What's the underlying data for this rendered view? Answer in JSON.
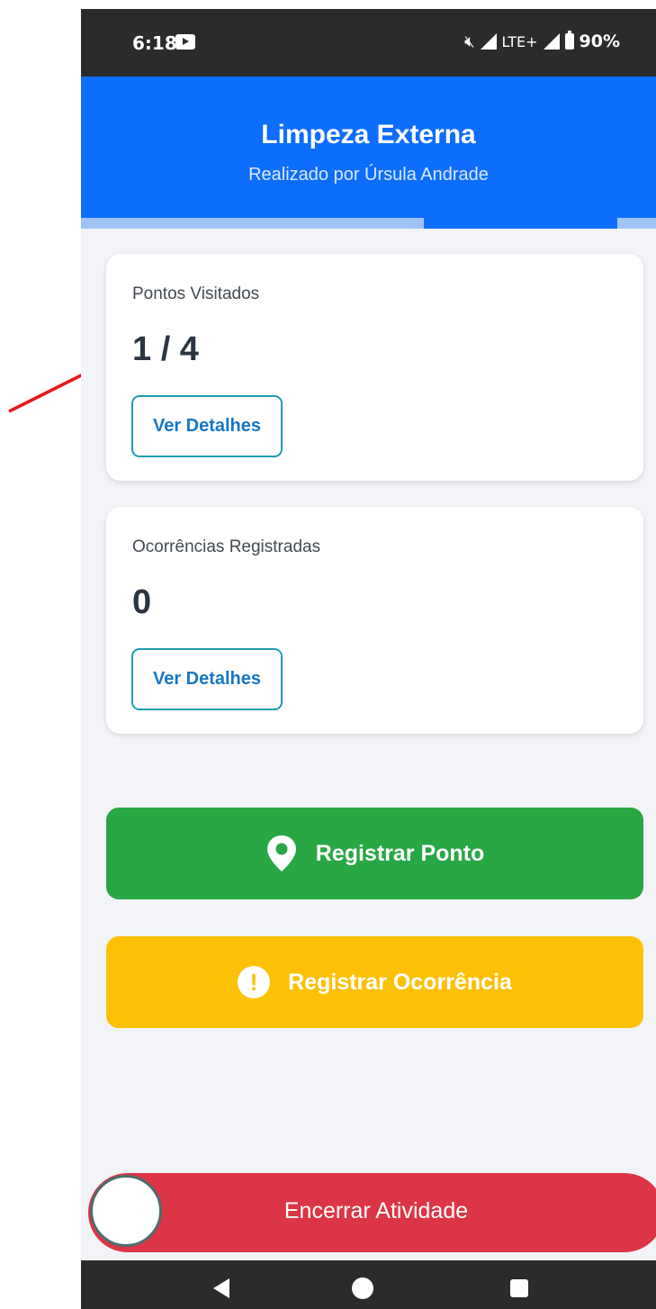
{
  "status_bar": {
    "time": "6:18",
    "network": "LTE+",
    "battery": "90%",
    "icons": [
      "youtube-icon",
      "mute-icon",
      "signal-icon",
      "battery-icon"
    ]
  },
  "header": {
    "title": "Limpeza Externa",
    "subtitle": "Realizado por Úrsula Andrade",
    "color": "#0d6efd"
  },
  "cards": [
    {
      "label": "Pontos Visitados",
      "value": "1 / 4",
      "button_label": "Ver Detalhes"
    },
    {
      "label": "Ocorrências Registradas",
      "value": "0",
      "button_label": "Ver Detalhes"
    }
  ],
  "actions": {
    "register_point": {
      "label": "Registrar Ponto",
      "icon": "map-pin-icon",
      "color": "#28a745"
    },
    "register_occurrence": {
      "label": "Registrar Ocorrência",
      "icon": "alert-icon",
      "color": "#fcc107"
    }
  },
  "end_activity": {
    "label": "Encerrar Atividade",
    "color": "#dc3545"
  },
  "nav_bar": {
    "icons": [
      "back-icon",
      "home-icon",
      "recents-icon"
    ]
  },
  "annotation": {
    "color": "#e8141b"
  }
}
